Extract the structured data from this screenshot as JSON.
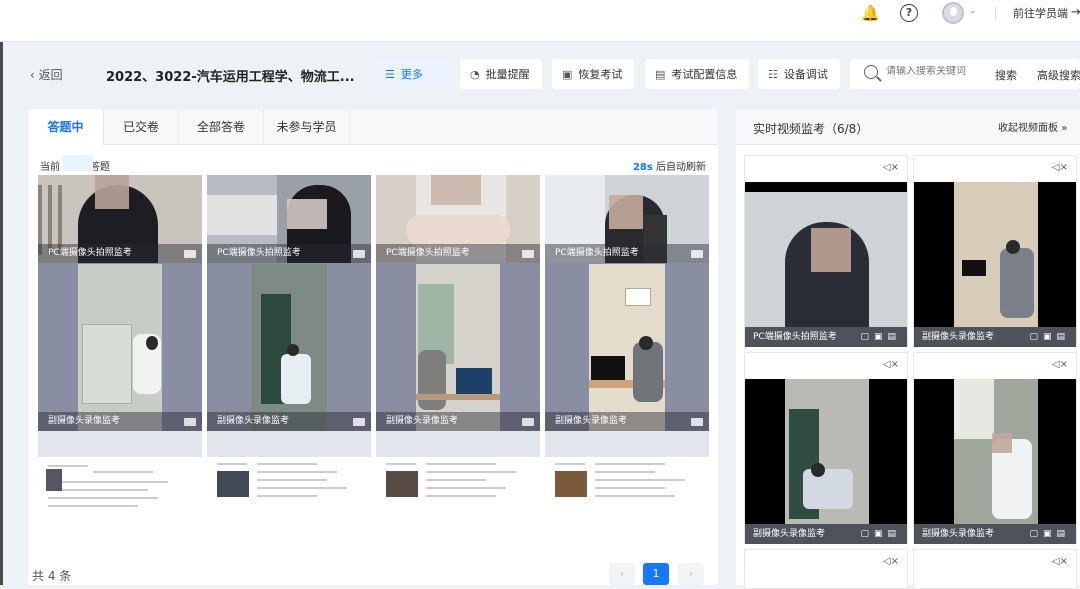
{
  "topbar": {
    "go_student": "前往学员端",
    "icons": [
      "bell-icon",
      "help-icon",
      "avatar",
      "exit-icon"
    ]
  },
  "header": {
    "back": "返回",
    "title": "2022、3022-汽车运用工程学、物流工...",
    "buttons": {
      "more": "更多",
      "batch_remind": "批量提醒",
      "restore_exam": "恢复考试",
      "exam_config": "考试配置信息",
      "device_debug": "设备调试"
    },
    "search": {
      "placeholder": "请输入搜索关键词",
      "search_label": "搜索",
      "advanced_label": "高级搜索"
    }
  },
  "tabs": [
    "答题中",
    "已交卷",
    "全部答卷",
    "未参与学员"
  ],
  "status": {
    "current_prefix": "当前",
    "current_suffix": "答题",
    "refresh_seconds": "28s",
    "refresh_label": "后自动刷新"
  },
  "cards": [
    {
      "pc_caption": "PC端摄像头拍照监考",
      "sub_caption": "副摄像头录像监考"
    },
    {
      "pc_caption": "PC端摄像头拍照监考",
      "sub_caption": "副摄像头录像监考"
    },
    {
      "pc_caption": "PC端摄像头拍照监考",
      "sub_caption": "副摄像头录像监考"
    },
    {
      "pc_caption": "PC端摄像头拍照监考",
      "sub_caption": "副摄像头录像监考"
    }
  ],
  "pagination": {
    "total": "共 4 条",
    "current_page": "1"
  },
  "monitor": {
    "title": "实时视频监考（6/8）",
    "collapse": "收起视频面板",
    "feeds": [
      {
        "caption": "PC端摄像头拍照监考"
      },
      {
        "caption": "副摄像头录像监考"
      },
      {
        "caption": "副摄像头录像监考"
      },
      {
        "caption": "副摄像头录像监考"
      }
    ]
  }
}
